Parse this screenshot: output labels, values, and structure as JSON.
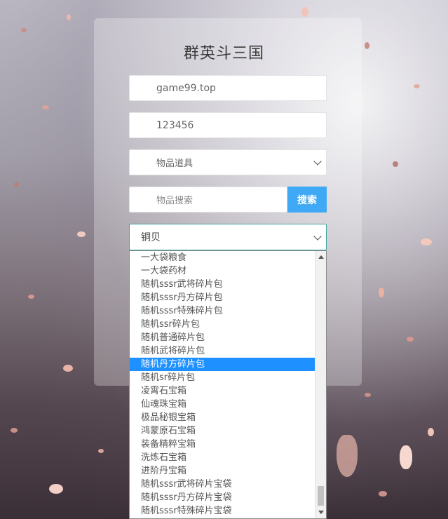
{
  "header": {
    "title": "群英斗三国"
  },
  "form": {
    "server_value": "game99.top",
    "account_value": "123456",
    "category_select": "物品道具",
    "search_placeholder": "物品搜索",
    "search_button": "搜索",
    "item_select": "铜贝"
  },
  "dropdown": {
    "options": [
      "一大袋粮食",
      "一大袋药材",
      "随机sssr武将碎片包",
      "随机sssr丹方碎片包",
      "随机sssr特殊碎片包",
      "随机ssr碎片包",
      "随机普通碎片包",
      "随机武将碎片包",
      "随机丹方碎片包",
      "随机sr碎片包",
      "凌霄石宝箱",
      "仙魂珠宝箱",
      "极品秘银宝箱",
      "鸿蒙原石宝箱",
      "装备精粹宝箱",
      "洗炼石宝箱",
      "进阶丹宝箱",
      "随机sssr武将碎片宝袋",
      "随机sssr丹方碎片宝袋",
      "随机sssr特殊碎片宝袋"
    ],
    "selected_index": 8
  },
  "colors": {
    "accent": "#3fa9f5",
    "highlight": "#1e90ff",
    "focus_border": "#3aa6a2"
  }
}
